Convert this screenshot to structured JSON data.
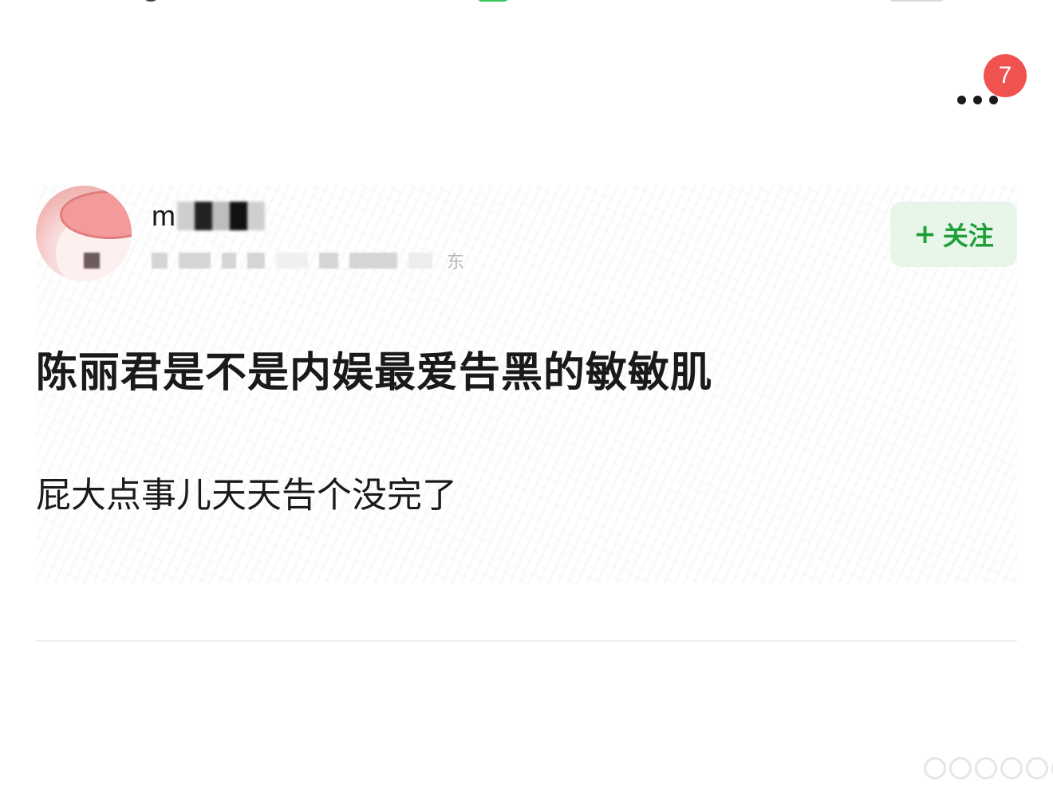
{
  "header": {
    "badge_count": "7",
    "more_icon": "more-horizontal-icon"
  },
  "author": {
    "name_visible": "m",
    "location_visible": "东",
    "follow_plus": "+",
    "follow_label": "关注"
  },
  "post": {
    "title": "陈丽君是不是内娱最爱告黑的敏敏肌",
    "body": "屁大点事儿天天告个没完了"
  },
  "colors": {
    "accent_green": "#1e9f3a",
    "follow_bg": "#e8f6ea",
    "badge_red": "#f0524f",
    "text": "#1a1a1a"
  }
}
